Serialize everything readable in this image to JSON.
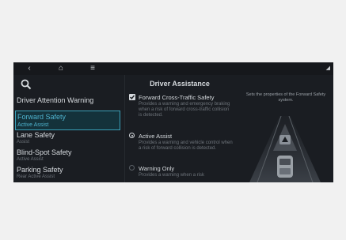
{
  "topbar": {
    "back_icon": "‹",
    "home_icon": "⌂",
    "menu_icon": "≡",
    "status_icon": "◢"
  },
  "sidebar": {
    "items": [
      {
        "label": "Driver Attention Warning",
        "sub": ""
      },
      {
        "label": "Forward Safety",
        "sub": "Active Assist",
        "selected": true
      },
      {
        "label": "Lane Safety",
        "sub": "Assist"
      },
      {
        "label": "Blind-Spot Safety",
        "sub": "Active Assist"
      },
      {
        "label": "Parking Safety",
        "sub": "Rear Active Assist"
      }
    ]
  },
  "panel": {
    "title": "Driver Assistance",
    "options": [
      {
        "label": "Forward Cross-Traffic Safety",
        "control": "checkbox",
        "checked": true,
        "desc": "Provides a warning and emergency braking when a risk of forward cross-traffic collision is detected."
      },
      {
        "label": "Active Assist",
        "control": "radio",
        "checked": true,
        "desc": "Provides a warning and vehicle control when a risk of forward collision is detected."
      },
      {
        "label": "Warning Only",
        "control": "radio",
        "checked": false,
        "desc": "Provides a warning when a risk"
      }
    ]
  },
  "help": {
    "text": "Sets the properties of the Forward Safety system."
  },
  "colors": {
    "selected_accent": "#3aa0b8",
    "background": "#1a1d22"
  }
}
